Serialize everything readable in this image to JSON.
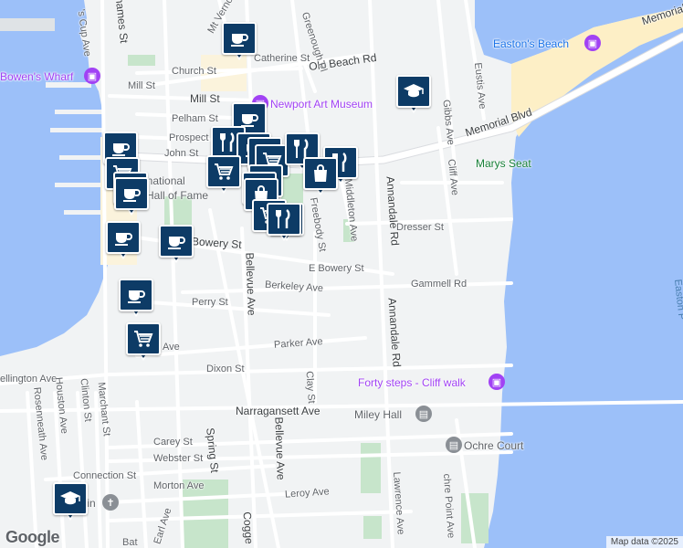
{
  "map": {
    "attribution": "Map data ©2025",
    "logo": "Google",
    "colors": {
      "water": "#9cc0f9",
      "land": "#f1f3f4",
      "road": "#ffffff",
      "park": "#c7e5cb",
      "beach": "#fdefc6",
      "pin": "#0d3b66",
      "poi": "#a142f4"
    }
  },
  "streets": [
    {
      "name": "Mill St"
    },
    {
      "name": "Church St"
    },
    {
      "name": "Catherine St"
    },
    {
      "name": "Old Beach Rd"
    },
    {
      "name": "Pelham St"
    },
    {
      "name": "Prospect"
    },
    {
      "name": "John St"
    },
    {
      "name": "Bowery St"
    },
    {
      "name": "E Bowery St"
    },
    {
      "name": "Berkeley Ave"
    },
    {
      "name": "Perry St"
    },
    {
      "name": "Dixon St"
    },
    {
      "name": "Parker Ave"
    },
    {
      "name": "Ave"
    },
    {
      "name": "ellington Ave"
    },
    {
      "name": "Narragansett Ave"
    },
    {
      "name": "Carey St"
    },
    {
      "name": "Webster St"
    },
    {
      "name": "Connection St"
    },
    {
      "name": "Morton Ave"
    },
    {
      "name": "Leroy Ave"
    },
    {
      "name": "Dresser St"
    },
    {
      "name": "Gammell Rd"
    },
    {
      "name": "Memorial Blvd"
    },
    {
      "name": "Memorial"
    },
    {
      "name": "Bellevue Ave"
    },
    {
      "name": "Spring St"
    },
    {
      "name": "Annandale Rd"
    },
    {
      "name": "Middleton Ave"
    },
    {
      "name": "Freebody St"
    },
    {
      "name": "Clay St"
    },
    {
      "name": "Cliff Ave"
    },
    {
      "name": "Gibbs Ave"
    },
    {
      "name": "Eustis Ave"
    },
    {
      "name": "Greenough Pl"
    },
    {
      "name": "Mt Vernon"
    },
    {
      "name": "hames St"
    },
    {
      "name": "'s Cup Ave"
    },
    {
      "name": "Rosenneath Ave"
    },
    {
      "name": "Houston Ave"
    },
    {
      "name": "Clinton St"
    },
    {
      "name": "Marchant St"
    },
    {
      "name": "Earl Ave"
    },
    {
      "name": "Lawrence Ave"
    },
    {
      "name": "chre Point Ave"
    },
    {
      "name": "Cogge"
    },
    {
      "name": "Bat"
    }
  ],
  "places": [
    {
      "name": "Easton's Beach",
      "kind": "camera"
    },
    {
      "name": "Bowen's Wharf",
      "kind": "camera"
    },
    {
      "name": "Newport Art Museum",
      "kind": "camera"
    },
    {
      "name": "Marys Seat",
      "kind": "green"
    },
    {
      "name": "Forty steps - Cliff walk",
      "kind": "camera"
    },
    {
      "name": "Miley Hall",
      "kind": "building"
    },
    {
      "name": "Ochre Court",
      "kind": "building"
    },
    {
      "name": "Augustin",
      "kind": "church"
    },
    {
      "name": "ernational",
      "kind": "text"
    },
    {
      "name": "Hall of Fame",
      "kind": "text"
    },
    {
      "name": "Easton P",
      "kind": "water"
    }
  ],
  "markers": [
    {
      "icon": "coffee-icon"
    },
    {
      "icon": "school-icon"
    },
    {
      "icon": "coffee-icon"
    },
    {
      "icon": "fork-knife-icon"
    },
    {
      "icon": "coffee-icon"
    },
    {
      "icon": "cart-icon"
    },
    {
      "icon": "cart-icon"
    },
    {
      "icon": "coffee-icon"
    },
    {
      "icon": "coffee-icon"
    },
    {
      "icon": "coffee-icon"
    },
    {
      "icon": "cart-icon"
    },
    {
      "icon": "fork-knife-icon"
    },
    {
      "icon": "fork-knife-icon"
    },
    {
      "icon": "cart-icon"
    },
    {
      "icon": "shopping-bag-icon"
    },
    {
      "icon": "fork-knife-icon"
    },
    {
      "icon": "cart-icon"
    },
    {
      "icon": "cart-icon"
    },
    {
      "icon": "shopping-bag-icon"
    },
    {
      "icon": "cart-icon"
    },
    {
      "icon": "fork-knife-icon"
    },
    {
      "icon": "cart-icon"
    },
    {
      "icon": "school-icon"
    }
  ]
}
